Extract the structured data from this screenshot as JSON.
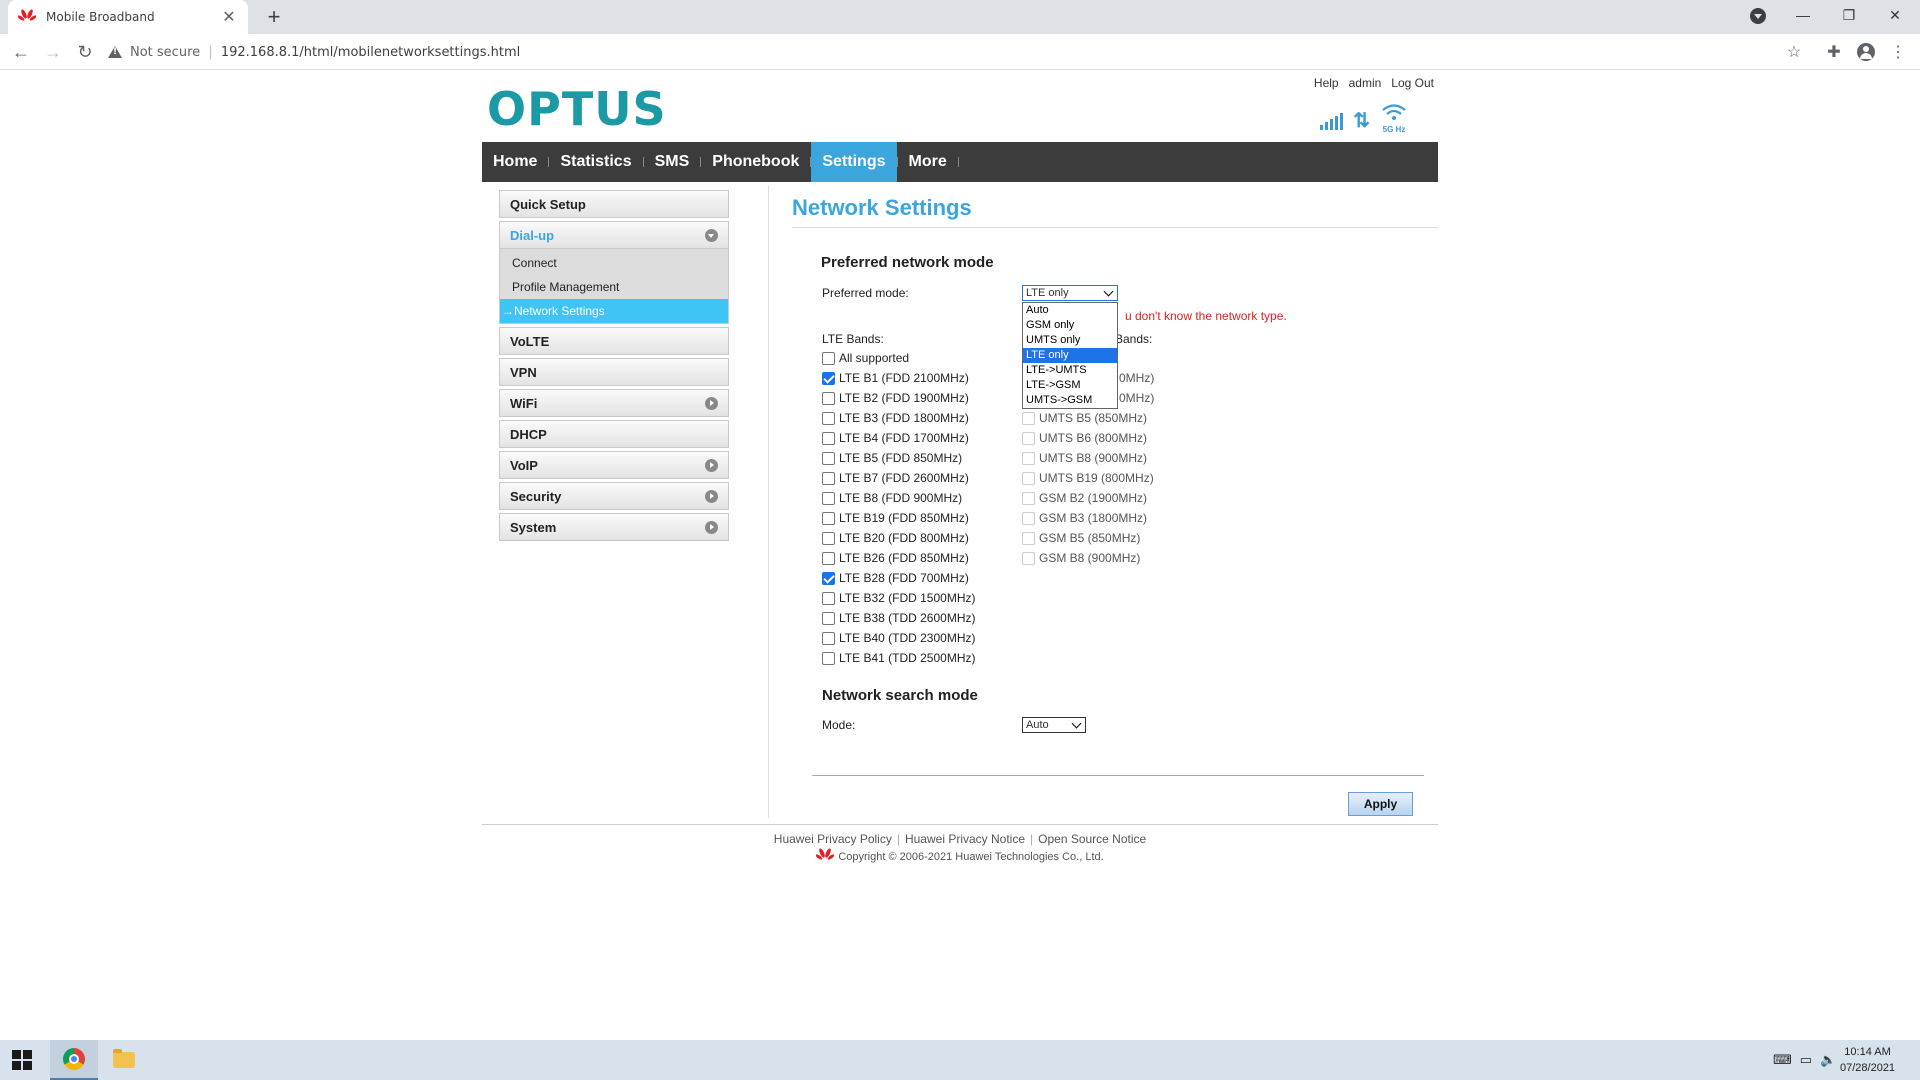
{
  "browser": {
    "tab_title": "Mobile Broadband",
    "tab_close": "✕",
    "new_tab": "+",
    "not_secure": "Not secure",
    "url": "192.168.8.1/html/mobilenetworksettings.html"
  },
  "header": {
    "logo": "OPTUS",
    "links": {
      "help": "Help",
      "admin": "admin",
      "logout": "Log Out"
    },
    "wifi_band": "5G Hz",
    "updown_glyph": "⇅"
  },
  "menu": {
    "items": [
      {
        "label": "Home",
        "active": false
      },
      {
        "label": "Statistics",
        "active": false
      },
      {
        "label": "SMS",
        "active": false
      },
      {
        "label": "Phonebook",
        "active": false
      },
      {
        "label": "Settings",
        "active": true
      },
      {
        "label": "More",
        "active": false
      }
    ]
  },
  "sidebar": {
    "quick_setup": "Quick Setup",
    "dialup": "Dial-up",
    "dialup_sub": [
      "Connect",
      "Profile Management",
      "Network Settings"
    ],
    "volte": "VoLTE",
    "vpn": "VPN",
    "wifi": "WiFi",
    "dhcp": "DHCP",
    "voip": "VoIP",
    "security": "Security",
    "system": "System"
  },
  "content": {
    "title": "Network Settings",
    "preferred_section": "Preferred network mode",
    "preferred_label": "Preferred mode:",
    "preferred_value": "LTE only",
    "hint": "u don't know the network type.",
    "lte_bands_label": "LTE Bands:",
    "other_bands_label": "Bands:",
    "all_supported": "All supported",
    "lte_bands": [
      {
        "label": "LTE B1 (FDD 2100MHz)",
        "checked": true
      },
      {
        "label": "LTE B2 (FDD 1900MHz)",
        "checked": false
      },
      {
        "label": "LTE B3 (FDD 1800MHz)",
        "checked": false
      },
      {
        "label": "LTE B4 (FDD 1700MHz)",
        "checked": false
      },
      {
        "label": "LTE B5 (FDD 850MHz)",
        "checked": false
      },
      {
        "label": "LTE B7 (FDD 2600MHz)",
        "checked": false
      },
      {
        "label": "LTE B8 (FDD 900MHz)",
        "checked": false
      },
      {
        "label": "LTE B19 (FDD 850MHz)",
        "checked": false
      },
      {
        "label": "LTE B20 (FDD 800MHz)",
        "checked": false
      },
      {
        "label": "LTE B26 (FDD 850MHz)",
        "checked": false
      },
      {
        "label": "LTE B28 (FDD 700MHz)",
        "checked": true
      },
      {
        "label": "LTE B32 (FDD 1500MHz)",
        "checked": false
      },
      {
        "label": "LTE B38 (TDD 2600MHz)",
        "checked": false
      },
      {
        "label": "LTE B40 (TDD 2300MHz)",
        "checked": false
      },
      {
        "label": "LTE B41 (TDD 2500MHz)",
        "checked": false
      }
    ],
    "other_bands_partial": [
      "0MHz)",
      "0MHz)"
    ],
    "other_bands": [
      "UMTS B5 (850MHz)",
      "UMTS B6 (800MHz)",
      "UMTS B8 (900MHz)",
      "UMTS B19 (800MHz)",
      "GSM B2 (1900MHz)",
      "GSM B3 (1800MHz)",
      "GSM B5 (850MHz)",
      "GSM B8 (900MHz)"
    ],
    "dropdown_options": [
      "Auto",
      "GSM only",
      "UMTS only",
      "LTE only",
      "LTE->UMTS",
      "LTE->GSM",
      "UMTS->GSM"
    ],
    "dropdown_selected": "LTE only",
    "search_section": "Network search mode",
    "mode_label": "Mode:",
    "mode_value": "Auto",
    "apply": "Apply"
  },
  "footer": {
    "links": [
      "Huawei Privacy Policy",
      "Huawei Privacy Notice",
      "Open Source Notice"
    ],
    "separator": "|",
    "copyright": "Copyright © 2006-2021 Huawei Technologies Co., Ltd."
  },
  "taskbar": {
    "time": "10:14 AM",
    "date": "07/28/2021"
  },
  "colors": {
    "accent": "#3aa6dd",
    "logo": "#1b9aa5",
    "menubar": "#3c3c3c",
    "hint": "#e02020"
  }
}
